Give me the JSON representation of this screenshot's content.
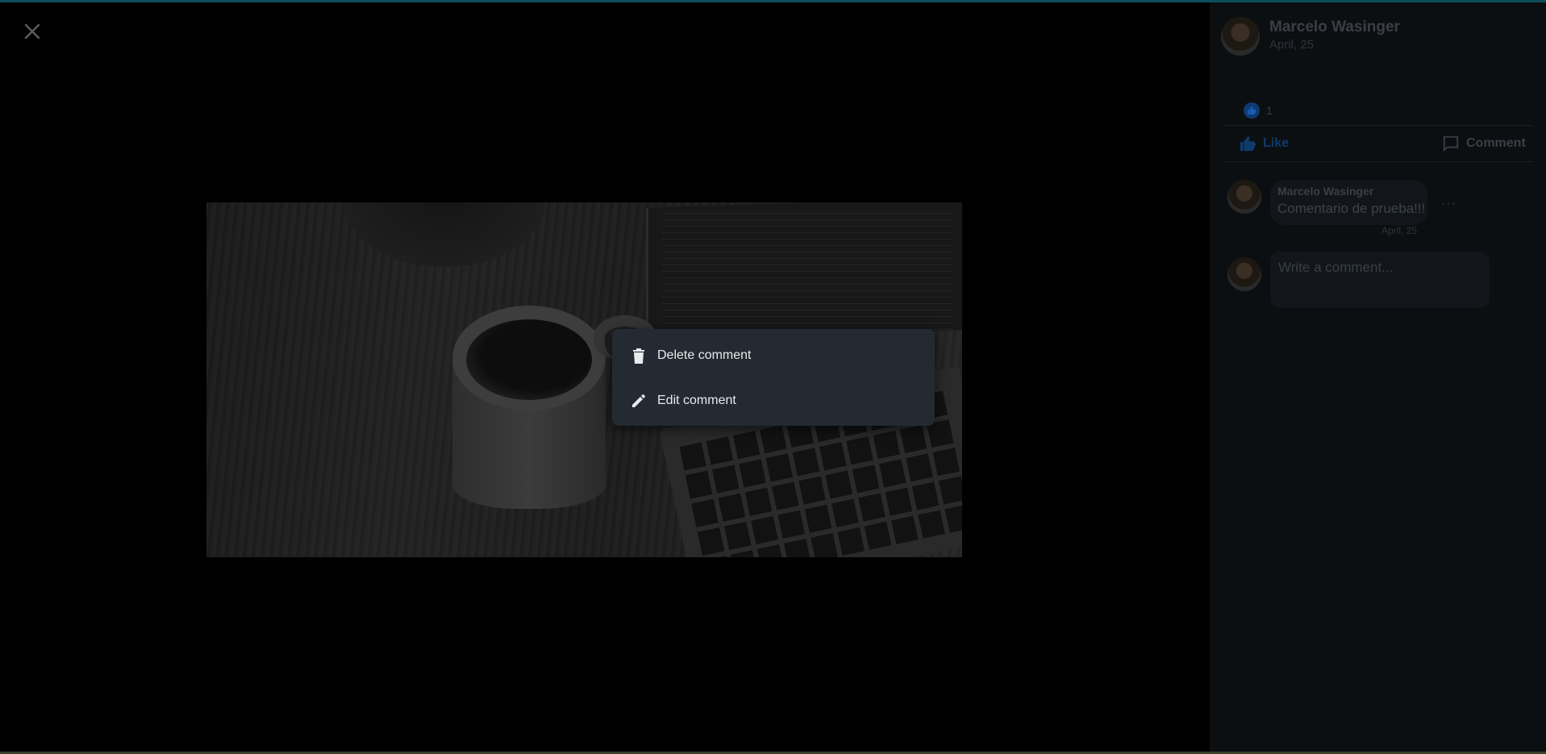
{
  "post": {
    "author": "Marcelo Wasinger",
    "date": "April, 25",
    "like_count": "1",
    "like_label": "Like",
    "comment_label": "Comment"
  },
  "comment": {
    "author": "Marcelo Wasinger",
    "text": "Comentario de prueba!!!",
    "date": "April, 25",
    "more": "···"
  },
  "composer": {
    "placeholder": "Write a comment..."
  },
  "context_menu": {
    "delete_label": "Delete comment",
    "edit_label": "Edit comment"
  },
  "icons": {
    "close": "close-icon",
    "delete": "trash-icon",
    "edit": "pencil-icon",
    "like": "thumbs-up-icon",
    "comment": "comment-icon"
  },
  "colors": {
    "menu_bg": "#232a31",
    "sidebar_bg": "#0c0f12",
    "top_accent": "#0e4e5c",
    "like_blue": "#0f3a6c"
  }
}
